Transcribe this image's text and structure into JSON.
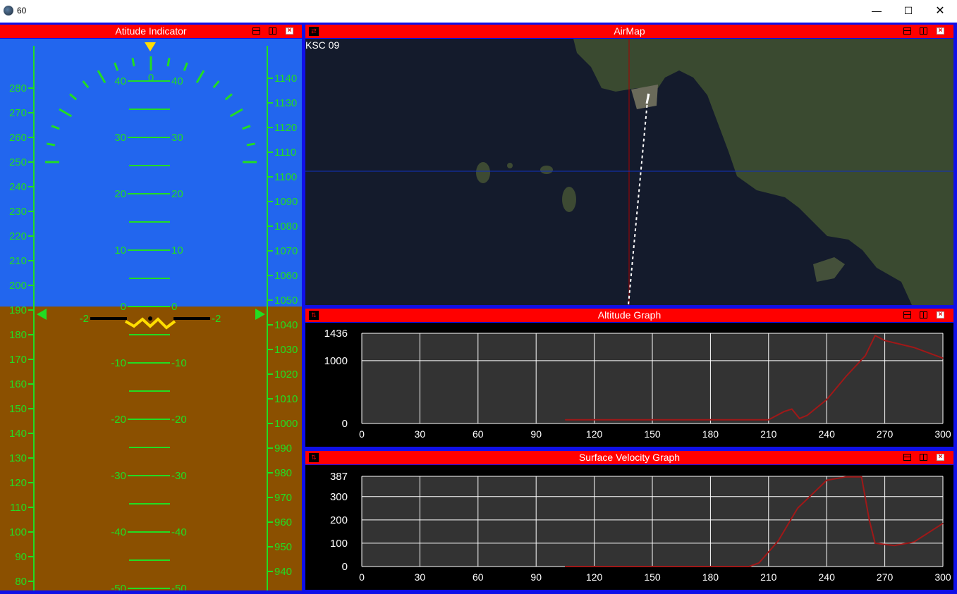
{
  "window": {
    "title": "60"
  },
  "attitude": {
    "title": "Atitude Indicator",
    "speed_ticks": [
      "280",
      "270",
      "260",
      "250",
      "240",
      "230",
      "220",
      "210",
      "200",
      "190",
      "180",
      "170",
      "160",
      "150",
      "140",
      "130",
      "120",
      "110",
      "100",
      "90",
      "80"
    ],
    "alt_ticks": [
      "1140",
      "1130",
      "1120",
      "1110",
      "1100",
      "1090",
      "1080",
      "1070",
      "1060",
      "1050",
      "1040",
      "1030",
      "1020",
      "1010",
      "1000",
      "990",
      "980",
      "970",
      "960",
      "950",
      "940"
    ],
    "pitch_labels": [
      "40",
      "30",
      "20",
      "10",
      "0",
      "-10",
      "-20",
      "-30",
      "-40",
      "-50"
    ],
    "roll_zero": "0",
    "horizon_minus": "-2",
    "sky_color": "#2266ee",
    "ground_color": "#8b5000",
    "scale_color": "#22dd22"
  },
  "airmap": {
    "title": "AirMap",
    "location_label": "KSC 09"
  },
  "altitude_graph": {
    "title": "Altitude Graph",
    "y_ticks": [
      "1436",
      "1000",
      "0"
    ],
    "x_ticks": [
      "0",
      "30",
      "60",
      "90",
      "120",
      "150",
      "180",
      "210",
      "240",
      "270",
      "300"
    ]
  },
  "velocity_graph": {
    "title": "Surface Velocity Graph",
    "y_ticks": [
      "387",
      "300",
      "200",
      "100",
      "0"
    ],
    "x_ticks": [
      "0",
      "30",
      "60",
      "90",
      "120",
      "150",
      "180",
      "210",
      "240",
      "270",
      "300"
    ]
  },
  "chart_data": [
    {
      "type": "line",
      "title": "Altitude Graph",
      "xlabel": "",
      "ylabel": "",
      "xlim": [
        0,
        300
      ],
      "ylim": [
        0,
        1436
      ],
      "grid": true,
      "x": [
        105,
        120,
        150,
        180,
        210,
        218,
        222,
        226,
        230,
        240,
        250,
        260,
        265,
        270,
        285,
        300
      ],
      "y": [
        60,
        60,
        60,
        60,
        60,
        190,
        230,
        80,
        130,
        380,
        750,
        1080,
        1400,
        1320,
        1210,
        1040
      ]
    },
    {
      "type": "line",
      "title": "Surface Velocity Graph",
      "xlabel": "",
      "ylabel": "",
      "xlim": [
        0,
        300
      ],
      "ylim": [
        0,
        387
      ],
      "grid": true,
      "x": [
        105,
        150,
        200,
        205,
        215,
        225,
        240,
        250,
        258,
        262,
        265,
        275,
        285,
        300
      ],
      "y": [
        0,
        0,
        0,
        15,
        110,
        250,
        370,
        385,
        385,
        200,
        100,
        90,
        105,
        185
      ]
    }
  ]
}
